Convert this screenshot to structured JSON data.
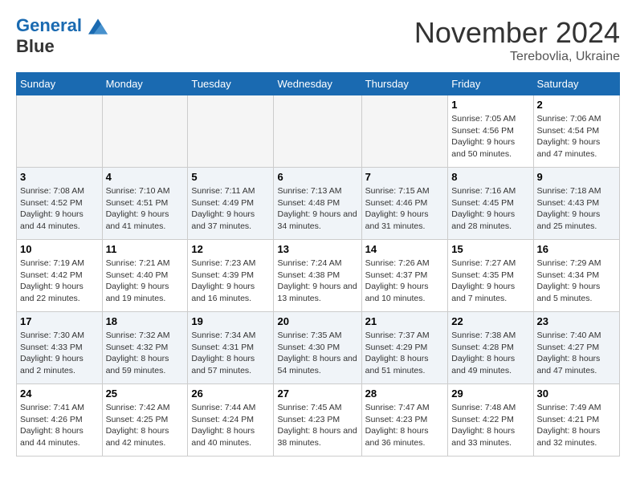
{
  "logo": {
    "line1": "General",
    "line2": "Blue"
  },
  "title": "November 2024",
  "location": "Terebovlia, Ukraine",
  "weekdays": [
    "Sunday",
    "Monday",
    "Tuesday",
    "Wednesday",
    "Thursday",
    "Friday",
    "Saturday"
  ],
  "weeks": [
    [
      {
        "day": "",
        "info": ""
      },
      {
        "day": "",
        "info": ""
      },
      {
        "day": "",
        "info": ""
      },
      {
        "day": "",
        "info": ""
      },
      {
        "day": "",
        "info": ""
      },
      {
        "day": "1",
        "info": "Sunrise: 7:05 AM\nSunset: 4:56 PM\nDaylight: 9 hours and 50 minutes."
      },
      {
        "day": "2",
        "info": "Sunrise: 7:06 AM\nSunset: 4:54 PM\nDaylight: 9 hours and 47 minutes."
      }
    ],
    [
      {
        "day": "3",
        "info": "Sunrise: 7:08 AM\nSunset: 4:52 PM\nDaylight: 9 hours and 44 minutes."
      },
      {
        "day": "4",
        "info": "Sunrise: 7:10 AM\nSunset: 4:51 PM\nDaylight: 9 hours and 41 minutes."
      },
      {
        "day": "5",
        "info": "Sunrise: 7:11 AM\nSunset: 4:49 PM\nDaylight: 9 hours and 37 minutes."
      },
      {
        "day": "6",
        "info": "Sunrise: 7:13 AM\nSunset: 4:48 PM\nDaylight: 9 hours and 34 minutes."
      },
      {
        "day": "7",
        "info": "Sunrise: 7:15 AM\nSunset: 4:46 PM\nDaylight: 9 hours and 31 minutes."
      },
      {
        "day": "8",
        "info": "Sunrise: 7:16 AM\nSunset: 4:45 PM\nDaylight: 9 hours and 28 minutes."
      },
      {
        "day": "9",
        "info": "Sunrise: 7:18 AM\nSunset: 4:43 PM\nDaylight: 9 hours and 25 minutes."
      }
    ],
    [
      {
        "day": "10",
        "info": "Sunrise: 7:19 AM\nSunset: 4:42 PM\nDaylight: 9 hours and 22 minutes."
      },
      {
        "day": "11",
        "info": "Sunrise: 7:21 AM\nSunset: 4:40 PM\nDaylight: 9 hours and 19 minutes."
      },
      {
        "day": "12",
        "info": "Sunrise: 7:23 AM\nSunset: 4:39 PM\nDaylight: 9 hours and 16 minutes."
      },
      {
        "day": "13",
        "info": "Sunrise: 7:24 AM\nSunset: 4:38 PM\nDaylight: 9 hours and 13 minutes."
      },
      {
        "day": "14",
        "info": "Sunrise: 7:26 AM\nSunset: 4:37 PM\nDaylight: 9 hours and 10 minutes."
      },
      {
        "day": "15",
        "info": "Sunrise: 7:27 AM\nSunset: 4:35 PM\nDaylight: 9 hours and 7 minutes."
      },
      {
        "day": "16",
        "info": "Sunrise: 7:29 AM\nSunset: 4:34 PM\nDaylight: 9 hours and 5 minutes."
      }
    ],
    [
      {
        "day": "17",
        "info": "Sunrise: 7:30 AM\nSunset: 4:33 PM\nDaylight: 9 hours and 2 minutes."
      },
      {
        "day": "18",
        "info": "Sunrise: 7:32 AM\nSunset: 4:32 PM\nDaylight: 8 hours and 59 minutes."
      },
      {
        "day": "19",
        "info": "Sunrise: 7:34 AM\nSunset: 4:31 PM\nDaylight: 8 hours and 57 minutes."
      },
      {
        "day": "20",
        "info": "Sunrise: 7:35 AM\nSunset: 4:30 PM\nDaylight: 8 hours and 54 minutes."
      },
      {
        "day": "21",
        "info": "Sunrise: 7:37 AM\nSunset: 4:29 PM\nDaylight: 8 hours and 51 minutes."
      },
      {
        "day": "22",
        "info": "Sunrise: 7:38 AM\nSunset: 4:28 PM\nDaylight: 8 hours and 49 minutes."
      },
      {
        "day": "23",
        "info": "Sunrise: 7:40 AM\nSunset: 4:27 PM\nDaylight: 8 hours and 47 minutes."
      }
    ],
    [
      {
        "day": "24",
        "info": "Sunrise: 7:41 AM\nSunset: 4:26 PM\nDaylight: 8 hours and 44 minutes."
      },
      {
        "day": "25",
        "info": "Sunrise: 7:42 AM\nSunset: 4:25 PM\nDaylight: 8 hours and 42 minutes."
      },
      {
        "day": "26",
        "info": "Sunrise: 7:44 AM\nSunset: 4:24 PM\nDaylight: 8 hours and 40 minutes."
      },
      {
        "day": "27",
        "info": "Sunrise: 7:45 AM\nSunset: 4:23 PM\nDaylight: 8 hours and 38 minutes."
      },
      {
        "day": "28",
        "info": "Sunrise: 7:47 AM\nSunset: 4:23 PM\nDaylight: 8 hours and 36 minutes."
      },
      {
        "day": "29",
        "info": "Sunrise: 7:48 AM\nSunset: 4:22 PM\nDaylight: 8 hours and 33 minutes."
      },
      {
        "day": "30",
        "info": "Sunrise: 7:49 AM\nSunset: 4:21 PM\nDaylight: 8 hours and 32 minutes."
      }
    ]
  ]
}
